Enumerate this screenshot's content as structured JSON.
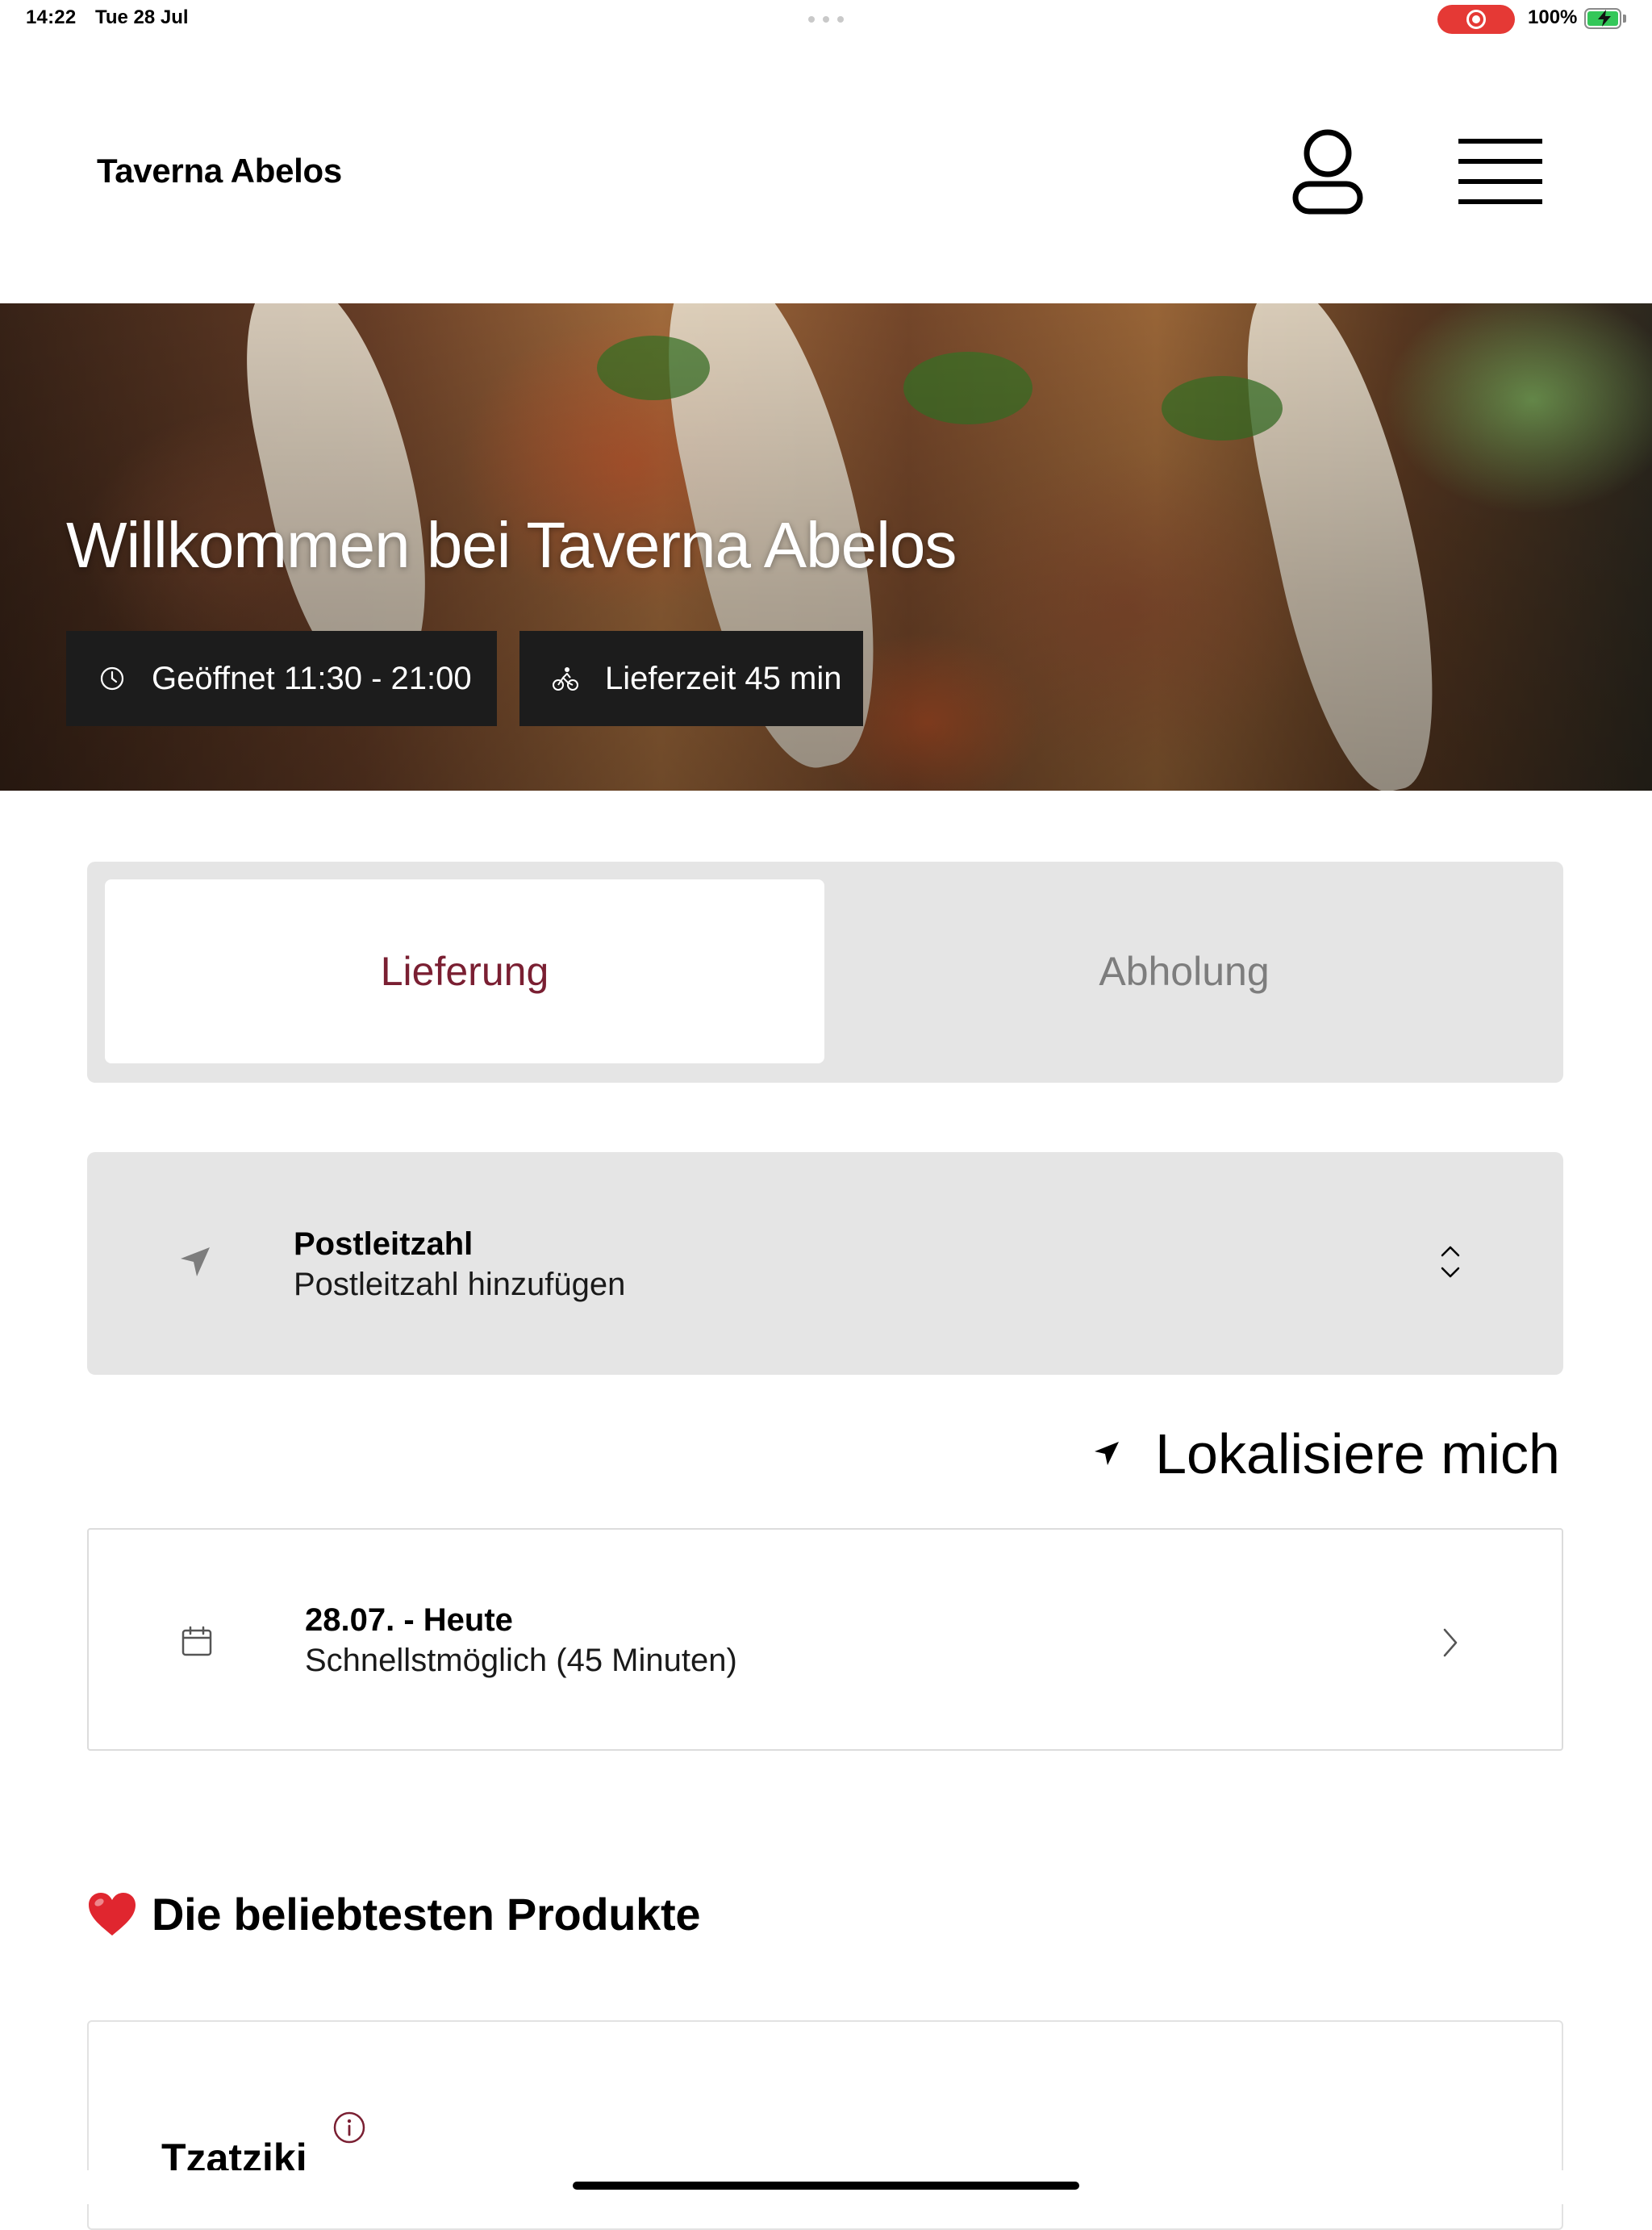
{
  "status_bar": {
    "time": "14:22",
    "date": "Tue 28 Jul",
    "battery_percent": "100%",
    "battery_level": 1.0,
    "recording_active": true,
    "colors": {
      "recording": "#e53935",
      "battery": "#34c759"
    }
  },
  "header": {
    "brand": "Taverna Abelos",
    "icons": [
      "user-icon",
      "menu-icon"
    ]
  },
  "hero": {
    "title": "Willkommen bei Taverna Abelos",
    "opening_hours": "Geöffnet 11:30 - 21:00",
    "delivery_time": "Lieferzeit 45 min",
    "icons": [
      "clock-icon",
      "bicycle-icon"
    ]
  },
  "order_mode": {
    "tabs": [
      {
        "label": "Lieferung",
        "selected": true
      },
      {
        "label": "Abholung",
        "selected": false
      }
    ],
    "colors": {
      "active_text": "#7a1f32",
      "inactive_text": "#7d7d7d",
      "background": "#e5e5e5"
    }
  },
  "postcode": {
    "label": "Postleitzahl",
    "placeholder": "Postleitzahl hinzufügen",
    "icons": [
      "location-arrow-icon",
      "chevron-up-down-icon"
    ]
  },
  "locate": {
    "label": "Lokalisiere mich",
    "icon": "location-arrow-icon"
  },
  "schedule": {
    "title": "28.07. - Heute",
    "subtitle": "Schnellstmöglich (45 Minuten)",
    "icons": [
      "calendar-icon",
      "chevron-right-icon"
    ]
  },
  "popular": {
    "emoji": "heart-icon",
    "title": "Die beliebtesten Produkte",
    "products": [
      {
        "name": "Tzatziki"
      }
    ],
    "colors": {
      "heart": "#e0262f",
      "info": "#7a1f32"
    }
  }
}
